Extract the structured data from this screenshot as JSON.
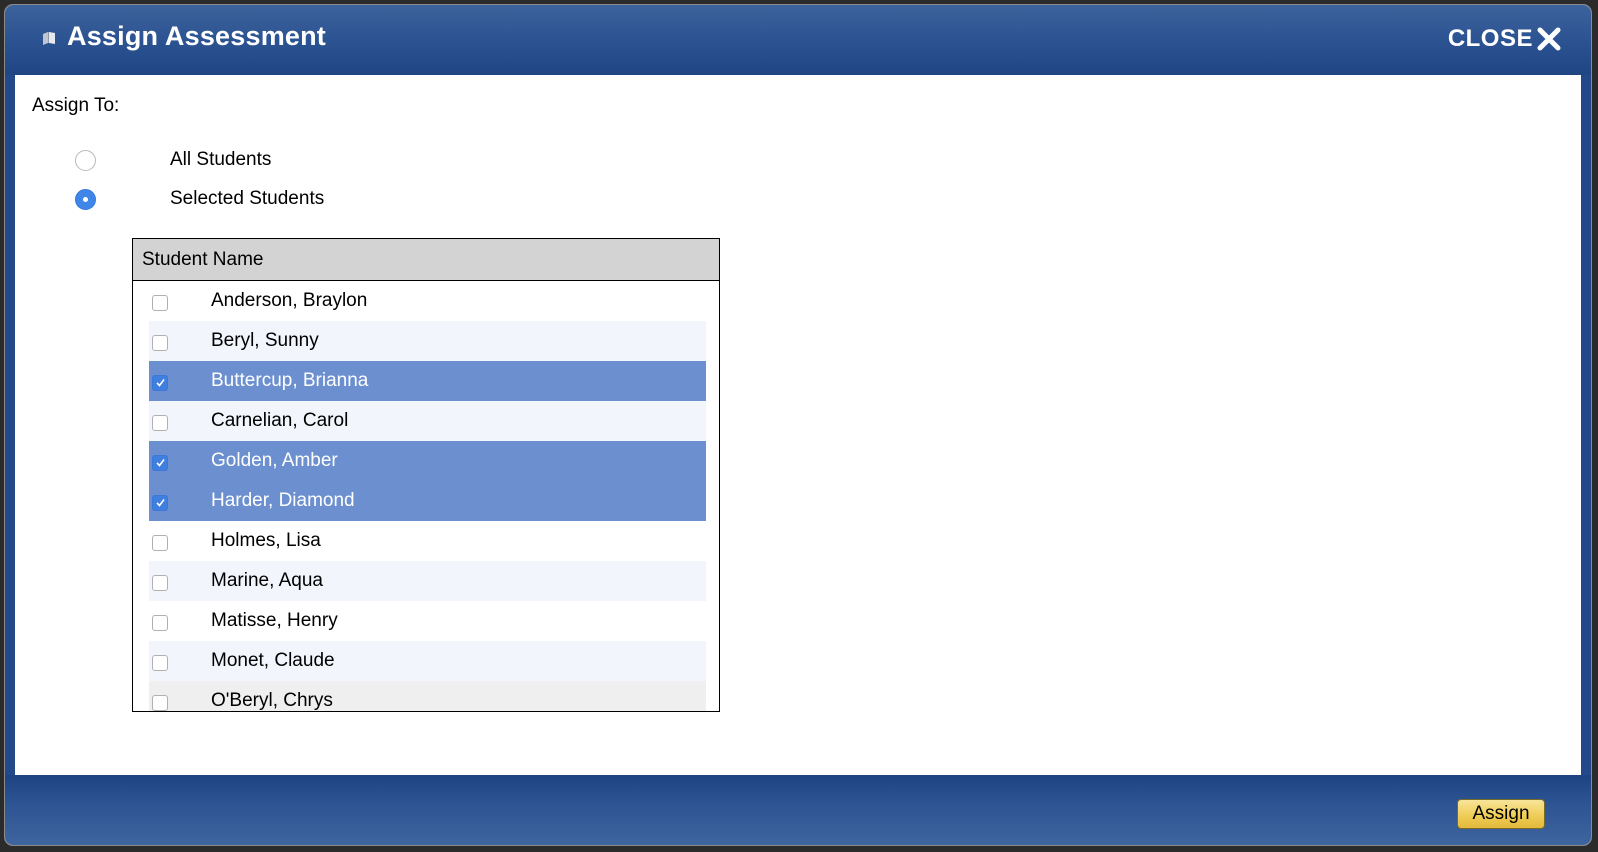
{
  "dialog": {
    "title": "Assign Assessment",
    "title_icon": "book-icon",
    "close_label": "CLOSE",
    "close_icon": "close-x-icon"
  },
  "assign_to": {
    "label": "Assign To:",
    "options": [
      {
        "label": "All Students",
        "checked": false
      },
      {
        "label": "Selected Students",
        "checked": true
      }
    ]
  },
  "student_table": {
    "header": "Student Name",
    "rows": [
      {
        "name": "Anderson, Braylon",
        "checked": false
      },
      {
        "name": "Beryl, Sunny",
        "checked": false
      },
      {
        "name": "Buttercup, Brianna",
        "checked": true
      },
      {
        "name": "Carnelian, Carol",
        "checked": false
      },
      {
        "name": "Golden, Amber",
        "checked": true
      },
      {
        "name": "Harder, Diamond",
        "checked": true
      },
      {
        "name": "Holmes, Lisa",
        "checked": false
      },
      {
        "name": "Marine, Aqua",
        "checked": false
      },
      {
        "name": "Matisse, Henry",
        "checked": false
      },
      {
        "name": "Monet, Claude",
        "checked": false
      },
      {
        "name": "O'Beryl, Chrys",
        "checked": false
      }
    ]
  },
  "footer": {
    "assign_label": "Assign"
  },
  "colors": {
    "title_bar": "#2e5593",
    "selected_row": "#6b8fcf",
    "assign_button": "#efcd57",
    "radio_checked": "#3f86e8"
  }
}
